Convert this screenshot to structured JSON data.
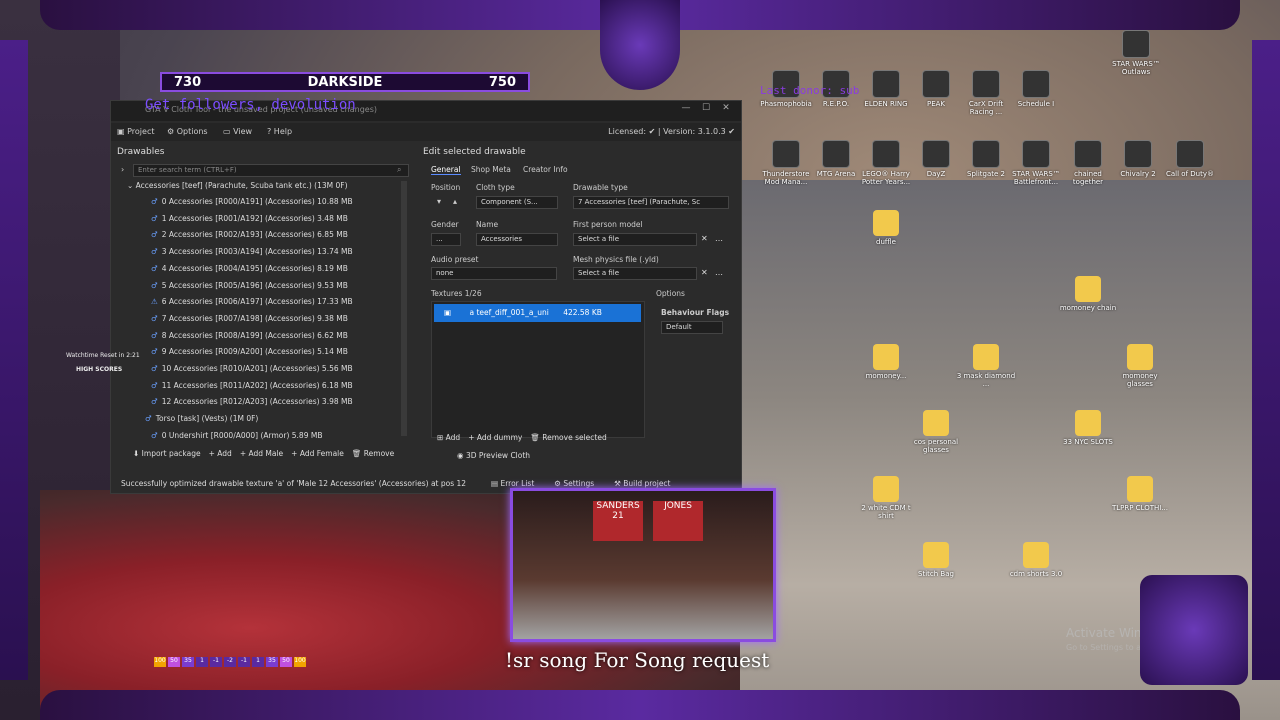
{
  "score": {
    "left": "730",
    "center": "DARKSIDE",
    "right": "750"
  },
  "app": {
    "title": "GTA V Cloth Tool - the unsaved project (unsaved changes)",
    "overlay_title": "Get followers, devolution",
    "menu": [
      "Project",
      "Options",
      "View",
      "Help"
    ],
    "license": "Licensed: ✔ | Version: 3.1.0.3 ✔",
    "drawables_title": "Drawables",
    "search_placeholder": "Enter search term (CTRL+F)",
    "group_label": "Accessories [teef] (Parachute, Scuba tank etc.) (13M 0F)",
    "rows": [
      "0 Accessories [R000/A191] (Accessories) 10.88 MB",
      "1 Accessories [R001/A192] (Accessories) 3.48 MB",
      "2 Accessories [R002/A193] (Accessories) 6.85 MB",
      "3 Accessories [R003/A194] (Accessories) 13.74 MB",
      "4 Accessories [R004/A195] (Accessories) 8.19 MB",
      "5 Accessories [R005/A196] (Accessories) 9.53 MB",
      "6 Accessories [R006/A197] (Accessories) 17.33 MB",
      "7 Accessories [R007/A198] (Accessories) 9.38 MB",
      "8 Accessories [R008/A199] (Accessories) 6.62 MB",
      "9 Accessories [R009/A200] (Accessories) 5.14 MB",
      "10 Accessories [R010/A201] (Accessories) 5.56 MB",
      "11 Accessories [R011/A202] (Accessories) 6.18 MB",
      "12 Accessories [R012/A203] (Accessories) 3.98 MB",
      "Torso [task] (Vests) (1M 0F)",
      "0 Undershirt [R000/A000] (Armor) 5.89 MB"
    ],
    "left_buttons": [
      "Import package",
      "Add",
      "Add Male",
      "Add Female",
      "Remove"
    ],
    "status": "Successfully optimized drawable texture 'a' of 'Male 12 Accessories' (Accessories) at pos 12",
    "edit_title": "Edit selected drawable",
    "tabs": [
      "General",
      "Shop Meta",
      "Creator Info"
    ],
    "position_label": "Position",
    "cloth_type_label": "Cloth type",
    "cloth_type_value": "Component (S...",
    "drawable_type_label": "Drawable type",
    "drawable_type_value": "7  Accessories [teef] (Parachute, Sc",
    "gender_label": "Gender",
    "gender_value": "...",
    "name_label": "Name",
    "name_value": "Accessories",
    "first_person_label": "First person model",
    "select_file": "Select a file",
    "audio_label": "Audio preset",
    "audio_value": "none",
    "mesh_label": "Mesh physics file (.yld)",
    "textures_label": "Textures 1/26",
    "texture_item": "a   teef_diff_001_a_uni",
    "texture_size": "422.58 KB",
    "options_label": "Options",
    "behaviour_label": "Behaviour Flags",
    "behaviour_value": "Default",
    "right_buttons": [
      "Add",
      "Add dummy",
      "Remove selected"
    ],
    "preview": "3D Preview Cloth",
    "bottom_buttons": [
      "Error List",
      "Settings",
      "Build project"
    ]
  },
  "desktop_icons": [
    {
      "label": "Phasmophobia",
      "type": "app"
    },
    {
      "label": "R.E.P.O.",
      "type": "app"
    },
    {
      "label": "ELDEN RING",
      "type": "app"
    },
    {
      "label": "PEAK",
      "type": "app"
    },
    {
      "label": "CarX Drift Racing ...",
      "type": "app"
    },
    {
      "label": "Schedule I",
      "type": "app"
    },
    {
      "label": "STAR WARS™ Outlaws",
      "type": "app"
    },
    {
      "label": "Thunderstore Mod Mana...",
      "type": "app"
    },
    {
      "label": "MTG Arena",
      "type": "app"
    },
    {
      "label": "LEGO® Harry Potter Years...",
      "type": "app"
    },
    {
      "label": "DayZ",
      "type": "app"
    },
    {
      "label": "Splitgate 2",
      "type": "app"
    },
    {
      "label": "STAR WARS™ Battlefront...",
      "type": "app"
    },
    {
      "label": "chained together",
      "type": "app"
    },
    {
      "label": "Chivalry 2",
      "type": "app"
    },
    {
      "label": "Call of Duty®",
      "type": "app"
    },
    {
      "label": "duffle",
      "type": "folder"
    },
    {
      "label": "momoney chain",
      "type": "folder"
    },
    {
      "label": "momoney...",
      "type": "folder"
    },
    {
      "label": "3 mask diamond ...",
      "type": "folder"
    },
    {
      "label": "momoney glasses",
      "type": "folder"
    },
    {
      "label": "cos personal glasses",
      "type": "folder"
    },
    {
      "label": "33 NYC SLOTS",
      "type": "folder"
    },
    {
      "label": "2 white CDM t shirt",
      "type": "folder"
    },
    {
      "label": "TLPRP CLOTHI...",
      "type": "folder"
    },
    {
      "label": "Stitch Bag",
      "type": "folder"
    },
    {
      "label": "cdm shorts 3.0",
      "type": "folder"
    }
  ],
  "stream": {
    "song_text": "!sr song For Song request",
    "overlay_text": "Last donor: sub",
    "watchtime": "Watchtime Reset in 2:21",
    "high_scores": "HIGH SCORES",
    "jersey1": "SANDERS 21",
    "jersey2": "JONES",
    "activate_windows": "Activate Windows",
    "activate_windows_sub": "Go to Settings to activate Windows.",
    "bars": [
      "100",
      "50",
      "35",
      "1",
      "-1",
      "-2",
      "-1",
      "1",
      "35",
      "50",
      "100"
    ]
  },
  "colors": {
    "accent": "#8a4ce0",
    "selection": "#1a72d6",
    "folder": "#f2c94c"
  }
}
